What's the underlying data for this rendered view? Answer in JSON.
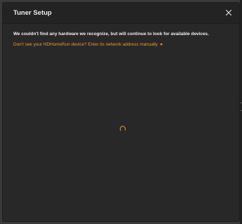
{
  "dialog": {
    "title": "Tuner Setup",
    "close_icon": "close-icon",
    "message": "We couldn't find any hardware we recognize, but will continue to look for available devices.",
    "manual_link": "Don't see your HDHomeRun device? Enter its network address manually",
    "manual_link_icon": "caret-down-icon",
    "loading_icon": "spinner-icon"
  },
  "colors": {
    "accent": "#e89a2e",
    "dialog_bg": "#282828",
    "header_bg": "#232323",
    "text": "#f0f0f0"
  }
}
